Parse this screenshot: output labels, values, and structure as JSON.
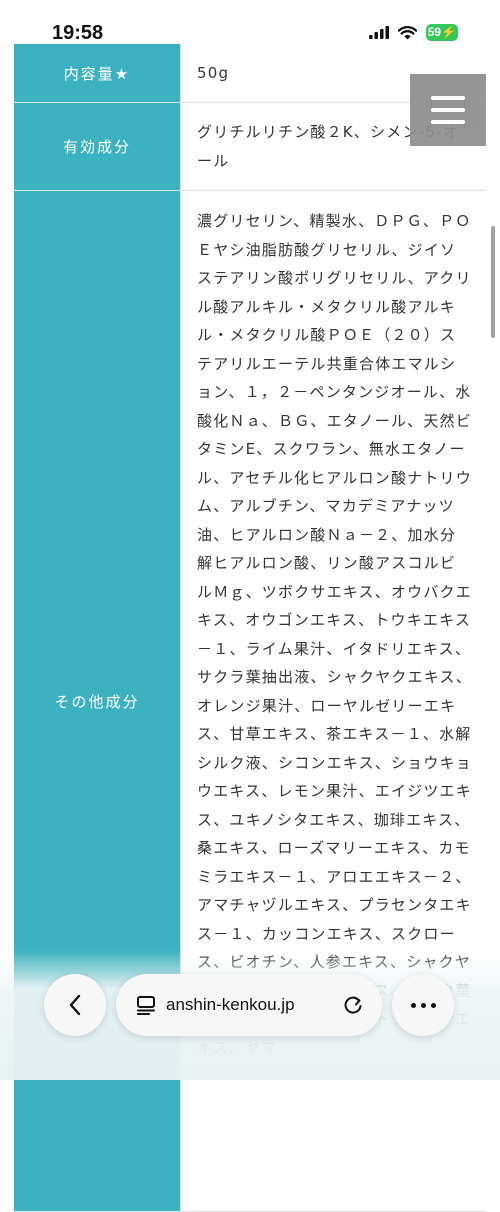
{
  "status_bar": {
    "time": "19:58",
    "battery": "59",
    "icons": [
      "cellular-signal-icon",
      "wifi-icon",
      "battery-charging-icon"
    ]
  },
  "table": {
    "rows": [
      {
        "header": "内容量★",
        "value": "50g"
      },
      {
        "header": "有効成分",
        "value": "グリチルリチン酸２K、シメン-5-オール"
      },
      {
        "header": "その他成分",
        "value": "濃グリセリン、精製水、ＤＰＧ、ＰＯＥヤシ油脂肪酸グリセリル、ジイソステアリン酸ポリグリセリル、アクリル酸アルキル・メタクリル酸アルキル・メタクリル酸ＰＯＥ（２０）ステアリルエーテル共重合体エマルション、１，２－ペンタンジオール、水酸化Ｎａ、ＢＧ、エタノール、天然ビタミンE、スクワラン、無水エタノール、アセチル化ヒアルロン酸ナトリウム、アルブチン、マカデミアナッツ油、ヒアルロン酸Ｎａ－２、加水分解ヒアルロン酸、リン酸アスコルビルＭｇ、ツボクサエキス、オウバクエキス、オウゴンエキス、トウキエキス－１、ライム果汁、イタドリエキス、サクラ葉抽出液、シャクヤクエキス、オレンジ果汁、ローヤルゼリーエキス、甘草エキス、茶エキス－１、水解シルク液、シコンエキス、ショウキョウエキス、レモン果汁、エイジツエキス、ユキノシタエキス、珈琲エキス、桑エキス、ローズマリーエキス、カモミラエキス－１、アロエエキス－２、アマチャヅルエキス、プラセンタエキス－１、カッコンエキス、スクロース、ビオチン、人参エキス、シャクヤクエキス、イチョウエキス、ブドウ葉エキス、ゴボウエキス、トウガラシエキス、ヤマ"
      }
    ]
  },
  "menu": {
    "icon": "hamburger-menu-icon"
  },
  "browser_bar": {
    "url": "anshin-kenkou.jp",
    "back_icon": "chevron-left-icon",
    "tabs_icon": "tabs-icon",
    "reload_icon": "reload-icon",
    "more_icon": "more-dots-icon"
  }
}
